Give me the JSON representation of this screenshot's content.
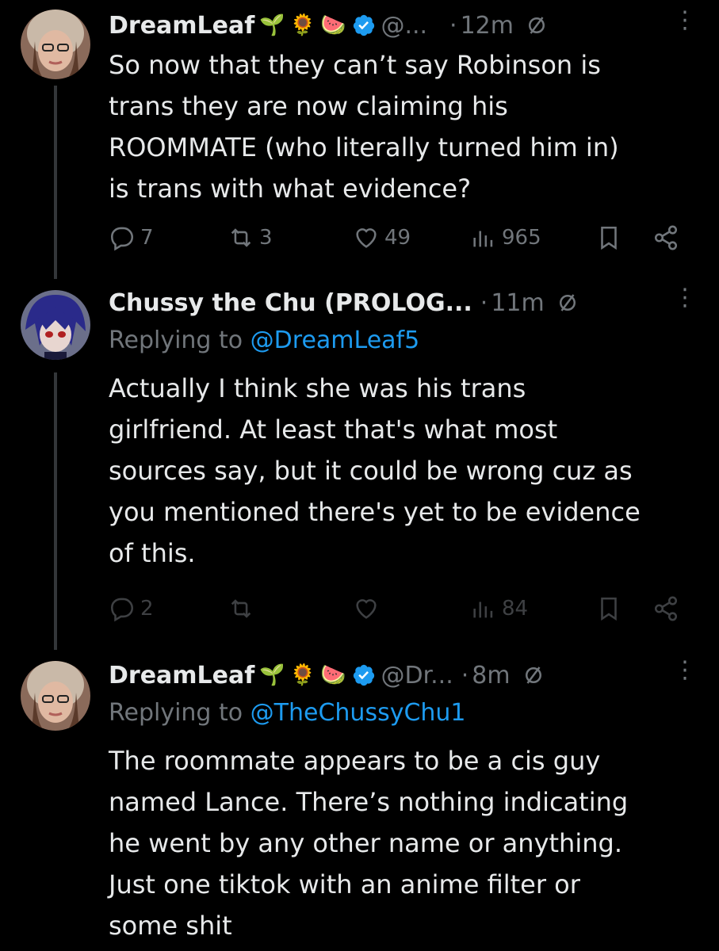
{
  "tweets": [
    {
      "name": "DreamLeaf",
      "emojis": [
        "🌱",
        "🌻",
        "🍉"
      ],
      "handle": "@...",
      "time": "12m",
      "replying_prefix": "",
      "replying_to": "",
      "text": "So now that they can’t say Robinson is\ntrans they are now claiming his\nROOMMATE (who literally turned him in)\nis trans with what evidence?",
      "replies": "7",
      "reposts": "3",
      "likes": "49",
      "views": "965"
    },
    {
      "name": "Chussy the Chu (PROLOG...",
      "handle": "",
      "time": "11m",
      "replying_prefix": "Replying to ",
      "replying_to": "@DreamLeaf5",
      "text": "Actually I think she was his trans\ngirlfriend. At least that's what most\nsources say, but it could be wrong cuz as\nyou mentioned there's yet to be evidence\nof this.",
      "replies": "2",
      "reposts": "",
      "likes": "",
      "views": "84"
    },
    {
      "name": "DreamLeaf",
      "emojis": [
        "🌱",
        "🌻",
        "🍉"
      ],
      "handle": "@Dr...",
      "time": "8m",
      "replying_prefix": "Replying to ",
      "replying_to": "@TheChussyChu1",
      "text": "The roommate appears to be a cis guy\nnamed Lance. There’s nothing indicating\nhe went by any other name or anything.\nJust one tiktok with an anime filter or\nsome shit"
    }
  ],
  "separator": "·",
  "colors": {
    "background": "#000000",
    "text": "#e7e9ea",
    "muted": "#71767b",
    "link": "#1d9bf0",
    "verified": "#1d9bf0"
  }
}
